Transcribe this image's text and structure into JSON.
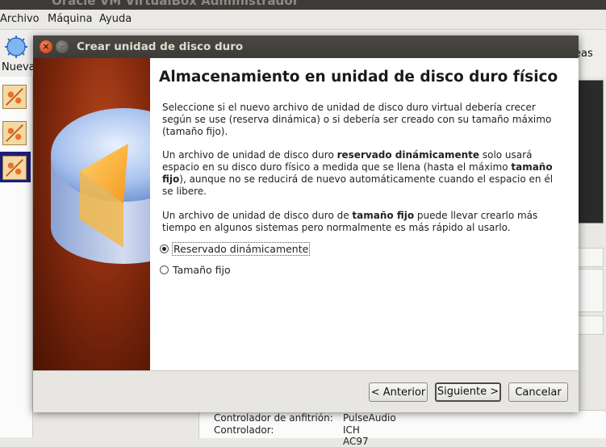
{
  "background": {
    "window_title": "Oracle VM VirtualBox Administrador",
    "menu": [
      {
        "label": "Archivo"
      },
      {
        "label": "Máquina"
      },
      {
        "label": "Ayuda"
      }
    ],
    "toolbar": {
      "new_label": "Nueva",
      "right_label": "eas"
    },
    "details": [
      {
        "label": "Controlador de anfitrión:",
        "value": "PulseAudio"
      },
      {
        "label": "Controlador:",
        "value": "ICH AC97"
      }
    ]
  },
  "dialog": {
    "title": "Crear unidad de disco duro",
    "heading": "Almacenamiento en unidad de disco duro físico",
    "paragraph1": "Seleccione si el nuevo archivo de unidad de disco duro virtual debería crecer según se use (reserva dinámica) o si debería ser creado con su tamaño máximo (tamaño fijo).",
    "paragraph2": {
      "part1": "Un archivo de unidad de disco duro ",
      "bold1": "reservado dinámicamente",
      "part2": " solo usará espacio en su disco duro físico a medida que se llena (hasta el máximo ",
      "bold2": "tamaño fijo",
      "part3": "), aunque no se reducirá de nuevo automáticamente cuando el espacio en él se libere."
    },
    "paragraph3": {
      "part1": "Un archivo de unidad de disco duro de ",
      "bold1": "tamaño fijo",
      "part2": " puede llevar crearlo más tiempo en algunos sistemas pero normalmente es más rápido al usarlo."
    },
    "options": [
      {
        "label": "Reservado dinámicamente",
        "checked": true
      },
      {
        "label": "Tamaño fijo",
        "checked": false
      }
    ],
    "buttons": {
      "back": "< Anterior",
      "next": "Siguiente >",
      "cancel": "Cancelar"
    }
  }
}
